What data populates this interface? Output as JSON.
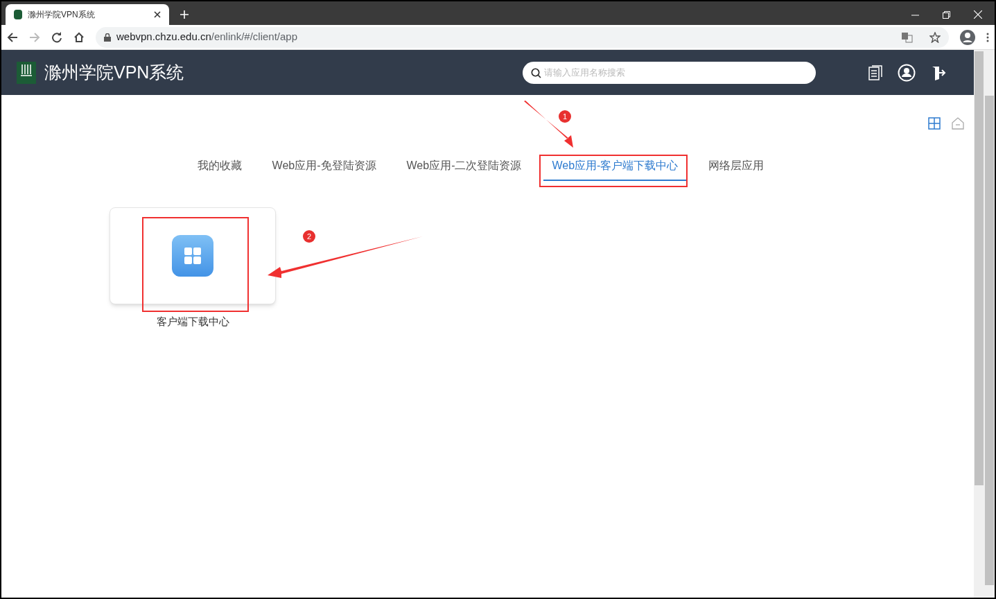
{
  "browser": {
    "tab_title": "滁州学院VPN系统",
    "url_host": "webvpn.chzu.edu.cn",
    "url_path": "/enlink/#/client/app"
  },
  "header": {
    "title": "滁州学院VPN系统",
    "search": {
      "placeholder": "请输入应用名称搜索"
    }
  },
  "tabs": [
    {
      "label": "我的收藏",
      "selected": false
    },
    {
      "label": "Web应用-免登陆资源",
      "selected": false
    },
    {
      "label": "Web应用-二次登陆资源",
      "selected": false
    },
    {
      "label": "Web应用-客户端下载中心",
      "selected": true
    },
    {
      "label": "网络层应用",
      "selected": false
    }
  ],
  "apps": [
    {
      "name": "客户端下载中心"
    }
  ],
  "annotations": [
    {
      "label": "1"
    },
    {
      "label": "2"
    }
  ]
}
